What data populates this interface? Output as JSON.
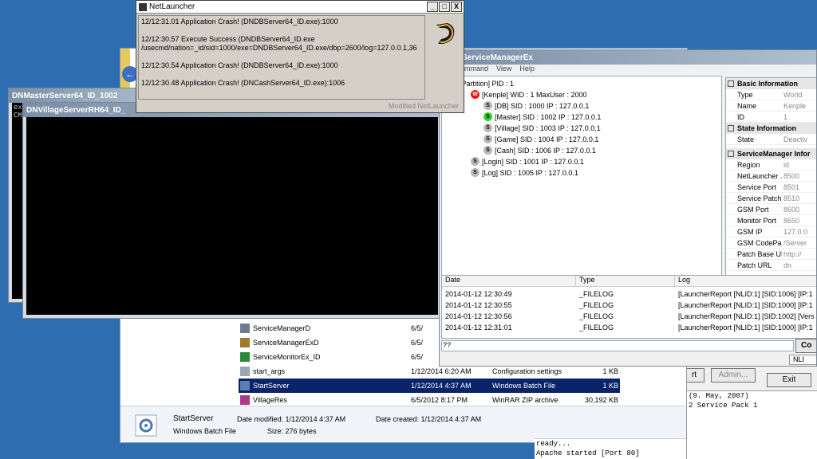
{
  "netlauncher": {
    "title": "NetLauncher",
    "log": [
      "12/12:31.01 Application Crash! (DNDBServer64_ID.exe):1000",
      "12/12:30.57 Execute Success (DNDBServer64_ID.exe",
      "/usecmd/nation=_id/sid=1000/exe=DNDBServer64_ID.exe/dbp=2600/log=127.0.0.1,36",
      "12/12:30.54 Application Crash! (DNDBServer64_ID.exe):1000",
      "12/12:30.48 Application Crash! (DNCashServer64_ID.exe):1006"
    ],
    "footer": "Modified NetLauncher",
    "btn_min": "_",
    "btn_max": "□",
    "btn_close": "X"
  },
  "console1": {
    "title": "DNMasterServer64_ID_1002",
    "lines": [
      "ex",
      "CM"
    ]
  },
  "console2": {
    "title": "DNVillageServerRH64_ID_"
  },
  "explorer": {
    "files": [
      {
        "name": "ServiceManagerD",
        "date": "6/5/",
        "type": "",
        "size": ""
      },
      {
        "name": "ServiceManagerExD",
        "date": "6/5/",
        "type": "",
        "size": ""
      },
      {
        "name": "ServiceMonitorEx_ID",
        "date": "6/5/",
        "type": "",
        "size": ""
      },
      {
        "name": "start_args",
        "date": "1/12/2014 6:20 AM",
        "type": "Configuration settings",
        "size": "1 KB"
      },
      {
        "name": "StartServer",
        "date": "1/12/2014 4:37 AM",
        "type": "Windows Batch File",
        "size": "1 KB"
      },
      {
        "name": "VillageRes",
        "date": "6/5/2012 8:17 PM",
        "type": "WinRAR ZIP archive",
        "size": "30,192 KB"
      }
    ],
    "details": {
      "name": "StartServer",
      "type": "Windows Batch File",
      "modified": "Date modified: 1/12/2014 4:37 AM",
      "created": "Date created: 1/12/2014 4:37 AM",
      "size": "Size: 276 bytes"
    }
  },
  "smex": {
    "title": "ServiceManagerEx",
    "menu": [
      "ommand",
      "View",
      "Help"
    ],
    "tree": [
      {
        "badge": "",
        "text": "[Partition] PID : 1"
      },
      {
        "badge": "W",
        "text": "[Kenple] WID : 1 MaxUser : 2000"
      },
      {
        "badge": "S",
        "text": "[DB] SID : 1000 IP : 127.0.0.1"
      },
      {
        "badge": "S",
        "text": "[Master] SID : 1002 IP : 127.0.0.1"
      },
      {
        "badge": "S",
        "text": "[Village] SID : 1003 IP : 127.0.0.1"
      },
      {
        "badge": "S",
        "text": "[Game] SID : 1004 IP : 127.0.0.1"
      },
      {
        "badge": "S",
        "text": "[Cash] SID : 1006 IP : 127.0.0.1"
      },
      {
        "badge": "S",
        "text": "[Login] SID : 1001 IP : 127.0.0.1"
      },
      {
        "badge": "S",
        "text": "[Log] SID : 1005 IP : 127.0.0.1"
      }
    ],
    "props": {
      "basic_header": "Basic Information",
      "basic": [
        {
          "k": "Type",
          "v": "World"
        },
        {
          "k": "Name",
          "v": "Kenple"
        },
        {
          "k": "ID",
          "v": "1"
        }
      ],
      "state_header": "State Information",
      "state": [
        {
          "k": "State",
          "v": "Deactiv"
        }
      ],
      "sm_header": "ServiceManager Infor",
      "sm": [
        {
          "k": "Region",
          "v": "id"
        },
        {
          "k": "NetLauncher ...",
          "v": "8500"
        },
        {
          "k": "Service Port",
          "v": "8501"
        },
        {
          "k": "Service Patch...",
          "v": "8510"
        },
        {
          "k": "GSM Port",
          "v": "8600"
        },
        {
          "k": "Monitor Port",
          "v": "8650"
        },
        {
          "k": "GSM IP",
          "v": "127.0.0"
        },
        {
          "k": "GSM CodePage",
          "v": "/Server"
        },
        {
          "k": "Patch Base URL",
          "v": "http://"
        },
        {
          "k": "Patch URL",
          "v": "dn"
        }
      ]
    },
    "log_headers": [
      "Date",
      "Type",
      "Log"
    ],
    "log": [
      {
        "date": "2014-01-12 12:30:49",
        "type": "_FILELOG",
        "log": "[LauncherReport [NLID:1] [SID:1006] [IP:1"
      },
      {
        "date": "2014-01-12 12:30:55",
        "type": "_FILELOG",
        "log": "[LauncherReport [NLID:1] [SID:1000] [IP:1"
      },
      {
        "date": "2014-01-12 12:30:56",
        "type": "_FILELOG",
        "log": "[LauncherReport [NLID:1] [SID:1002] [Vers"
      },
      {
        "date": "2014-01-12 12:31:01",
        "type": "_FILELOG",
        "log": "[LauncherReport [NLID:1] [SID:1000] [IP:1"
      }
    ],
    "cmd_prompt": "??",
    "cmd_btn": "Co",
    "nlid": "NLI"
  },
  "apache": {
    "btn_start": "rt",
    "btn_admin": "Admin...",
    "btn_exit": "Exit",
    "log": "(9. May, 2007)\n2 Service Pack 1",
    "log2": "ready...\nApache started [Port 80]"
  }
}
